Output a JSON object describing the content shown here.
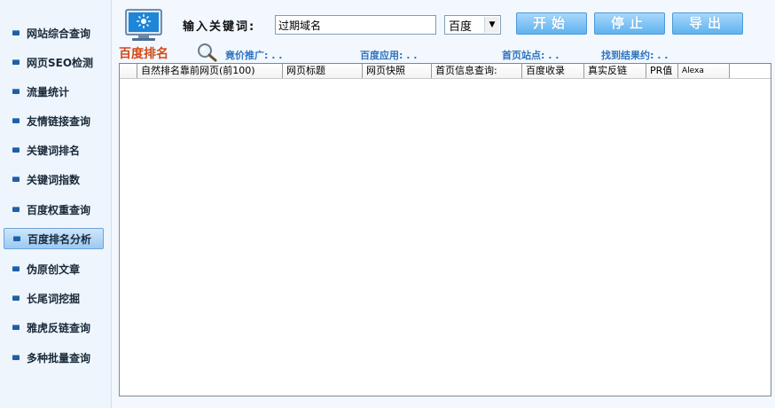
{
  "sidebar": {
    "items": [
      {
        "label": "网站综合查询",
        "active": false
      },
      {
        "label": "网页SEO检测",
        "active": false
      },
      {
        "label": "流量统计",
        "active": false
      },
      {
        "label": "友情链接查询",
        "active": false
      },
      {
        "label": "关键词排名",
        "active": false
      },
      {
        "label": "关键词指数",
        "active": false
      },
      {
        "label": "百度权重查询",
        "active": false
      },
      {
        "label": "百度排名分析",
        "active": true
      },
      {
        "label": "伪原创文章",
        "active": false
      },
      {
        "label": "长尾词挖掘",
        "active": false
      },
      {
        "label": "雅虎反链查询",
        "active": false
      },
      {
        "label": "多种批量查询",
        "active": false
      }
    ]
  },
  "toolbar": {
    "keyword_label": "输入关键词:",
    "keyword_value": "过期域名",
    "engine_value": "百度",
    "start_label": "开始",
    "stop_label": "停止",
    "export_label": "导出"
  },
  "section": {
    "title": "百度排名",
    "stats": {
      "ppc": "竟价推广: . .",
      "apps": "百度应用: . .",
      "homepage": "首页站点: . .",
      "results": "找到结果约: . ."
    }
  },
  "table": {
    "columns": [
      "",
      "自然排名靠前网页(前100)",
      "网页标题",
      "网页快照",
      "首页信息查询:",
      "百度收录",
      "真实反链",
      "PR值",
      "Alexa"
    ],
    "rows": []
  },
  "icons": {
    "monitor": "monitor-icon",
    "magnifier": "magnifier-icon",
    "bullet": "bullet-icon"
  },
  "colors": {
    "accent": "#2f74c0",
    "title": "#d24b1a",
    "button": "#5fb2ef"
  }
}
